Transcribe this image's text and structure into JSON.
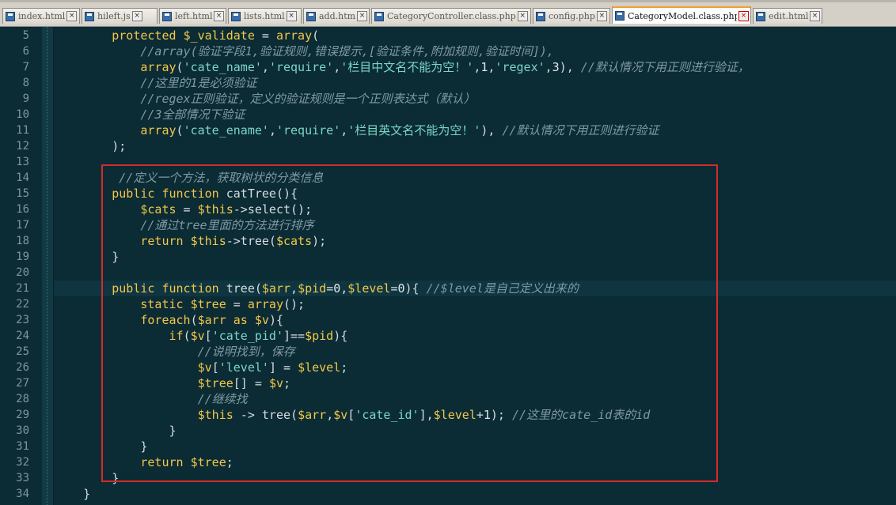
{
  "tabs": [
    {
      "label": "index.html",
      "active": false
    },
    {
      "label": "hileft.js",
      "active": false
    },
    {
      "label": "left.html",
      "active": false
    },
    {
      "label": "lists.html",
      "active": false
    },
    {
      "label": "add.html",
      "active": false
    },
    {
      "label": "CategoryController.class.php",
      "active": false
    },
    {
      "label": "config.php",
      "active": false
    },
    {
      "label": "CategoryModel.class.php",
      "active": true
    },
    {
      "label": "edit.html",
      "active": false
    }
  ],
  "colors": {
    "background": "#0b2b35",
    "keyword": "#f3c64a",
    "string": "#7bd7c5",
    "comment": "#7f9aa5",
    "highlight_box": "#d42b2b"
  },
  "code": {
    "current_line": 21,
    "lines": [
      {
        "n": "5",
        "fold": "",
        "tokens": [
          [
            "",
            "        "
          ],
          [
            "kw",
            "protected "
          ],
          [
            "var",
            "$_validate"
          ],
          [
            "op",
            " = "
          ],
          [
            "kw",
            "array"
          ],
          [
            "op",
            "("
          ]
        ]
      },
      {
        "n": "6",
        "fold": "",
        "tokens": [
          [
            "",
            "            "
          ],
          [
            "cmt",
            "//array(验证字段1,验证规则,错误提示,[验证条件,附加规则,验证时间]),"
          ]
        ]
      },
      {
        "n": "7",
        "fold": "",
        "tokens": [
          [
            "",
            "            "
          ],
          [
            "kw",
            "array"
          ],
          [
            "op",
            "("
          ],
          [
            "str",
            "'cate_name'"
          ],
          [
            "op",
            ","
          ],
          [
            "str",
            "'require'"
          ],
          [
            "op",
            ","
          ],
          [
            "str",
            "'栏目中文名不能为空！'"
          ],
          [
            "op",
            ","
          ],
          [
            "num",
            "1"
          ],
          [
            "op",
            ","
          ],
          [
            "str",
            "'regex'"
          ],
          [
            "op",
            ","
          ],
          [
            "num",
            "3"
          ],
          [
            "op",
            "), "
          ],
          [
            "cmt",
            "//默认情况下用正则进行验证，"
          ]
        ]
      },
      {
        "n": "8",
        "fold": "",
        "tokens": [
          [
            "",
            "            "
          ],
          [
            "cmt",
            "//这里的1是必须验证"
          ]
        ]
      },
      {
        "n": "9",
        "fold": "",
        "tokens": [
          [
            "",
            "            "
          ],
          [
            "cmt",
            "//regex正则验证，定义的验证规则是一个正则表达式（默认）"
          ]
        ]
      },
      {
        "n": "10",
        "fold": "",
        "tokens": [
          [
            "",
            "            "
          ],
          [
            "cmt",
            "//3全部情况下验证"
          ]
        ]
      },
      {
        "n": "11",
        "fold": "",
        "tokens": [
          [
            "",
            "            "
          ],
          [
            "kw",
            "array"
          ],
          [
            "op",
            "("
          ],
          [
            "str",
            "'cate_ename'"
          ],
          [
            "op",
            ","
          ],
          [
            "str",
            "'require'"
          ],
          [
            "op",
            ","
          ],
          [
            "str",
            "'栏目英文名不能为空！'"
          ],
          [
            "op",
            "), "
          ],
          [
            "cmt",
            "//默认情况下用正则进行验证"
          ]
        ]
      },
      {
        "n": "12",
        "fold": "",
        "tokens": [
          [
            "",
            "        "
          ],
          [
            "op",
            ");"
          ]
        ]
      },
      {
        "n": "13",
        "fold": "",
        "tokens": []
      },
      {
        "n": "14",
        "fold": "",
        "tokens": [
          [
            "",
            "         "
          ],
          [
            "cmt",
            "//定义一个方法，获取树状的分类信息"
          ]
        ]
      },
      {
        "n": "15",
        "fold": "box",
        "tokens": [
          [
            "",
            "        "
          ],
          [
            "kw",
            "public "
          ],
          [
            "kw",
            "function "
          ],
          [
            "op",
            "catTree(){"
          ]
        ]
      },
      {
        "n": "16",
        "fold": "",
        "tokens": [
          [
            "",
            "            "
          ],
          [
            "var",
            "$cats"
          ],
          [
            "op",
            " = "
          ],
          [
            "var",
            "$this"
          ],
          [
            "op",
            "->select();"
          ]
        ]
      },
      {
        "n": "17",
        "fold": "",
        "tokens": [
          [
            "",
            "            "
          ],
          [
            "cmt",
            "//通过tree里面的方法进行排序"
          ]
        ]
      },
      {
        "n": "18",
        "fold": "",
        "tokens": [
          [
            "",
            "            "
          ],
          [
            "kw",
            "return "
          ],
          [
            "var",
            "$this"
          ],
          [
            "op",
            "->tree("
          ],
          [
            "var",
            "$cats"
          ],
          [
            "op",
            ");"
          ]
        ]
      },
      {
        "n": "19",
        "fold": "",
        "tokens": [
          [
            "",
            "        "
          ],
          [
            "op",
            "}"
          ]
        ]
      },
      {
        "n": "20",
        "fold": "",
        "tokens": []
      },
      {
        "n": "21",
        "fold": "red",
        "tokens": [
          [
            "",
            "        "
          ],
          [
            "kw",
            "public "
          ],
          [
            "kw",
            "function "
          ],
          [
            "op",
            "tree("
          ],
          [
            "var",
            "$arr"
          ],
          [
            "op",
            ","
          ],
          [
            "var",
            "$pid"
          ],
          [
            "op",
            "="
          ],
          [
            "num",
            "0"
          ],
          [
            "op",
            ","
          ],
          [
            "var",
            "$level"
          ],
          [
            "op",
            "="
          ],
          [
            "num",
            "0"
          ],
          [
            "op",
            "){ "
          ],
          [
            "cmt",
            "//$level是自己定义出来的"
          ]
        ]
      },
      {
        "n": "22",
        "fold": "",
        "tokens": [
          [
            "",
            "            "
          ],
          [
            "kw",
            "static "
          ],
          [
            "var",
            "$tree"
          ],
          [
            "op",
            " = "
          ],
          [
            "kw",
            "array"
          ],
          [
            "op",
            "();"
          ]
        ]
      },
      {
        "n": "23",
        "fold": "red",
        "tokens": [
          [
            "",
            "            "
          ],
          [
            "kw",
            "foreach"
          ],
          [
            "op",
            "("
          ],
          [
            "var",
            "$arr"
          ],
          [
            "kw",
            " as "
          ],
          [
            "var",
            "$v"
          ],
          [
            "op",
            "){"
          ]
        ]
      },
      {
        "n": "24",
        "fold": "box",
        "tokens": [
          [
            "",
            "                "
          ],
          [
            "kw",
            "if"
          ],
          [
            "op",
            "("
          ],
          [
            "var",
            "$v"
          ],
          [
            "op",
            "["
          ],
          [
            "str",
            "'cate_pid'"
          ],
          [
            "op",
            "]=="
          ],
          [
            "var",
            "$pid"
          ],
          [
            "op",
            "){"
          ]
        ]
      },
      {
        "n": "25",
        "fold": "",
        "tokens": [
          [
            "",
            "                    "
          ],
          [
            "cmt",
            "//说明找到，保存"
          ]
        ]
      },
      {
        "n": "26",
        "fold": "",
        "tokens": [
          [
            "",
            "                    "
          ],
          [
            "var",
            "$v"
          ],
          [
            "op",
            "["
          ],
          [
            "str",
            "'level'"
          ],
          [
            "op",
            "] = "
          ],
          [
            "var",
            "$level"
          ],
          [
            "op",
            ";"
          ]
        ]
      },
      {
        "n": "27",
        "fold": "",
        "tokens": [
          [
            "",
            "                    "
          ],
          [
            "var",
            "$tree"
          ],
          [
            "op",
            "[] = "
          ],
          [
            "var",
            "$v"
          ],
          [
            "op",
            ";"
          ]
        ]
      },
      {
        "n": "28",
        "fold": "",
        "tokens": [
          [
            "",
            "                    "
          ],
          [
            "cmt",
            "//继续找"
          ]
        ]
      },
      {
        "n": "29",
        "fold": "",
        "tokens": [
          [
            "",
            "                    "
          ],
          [
            "var",
            "$this"
          ],
          [
            "op",
            " -> tree("
          ],
          [
            "var",
            "$arr"
          ],
          [
            "op",
            ","
          ],
          [
            "var",
            "$v"
          ],
          [
            "op",
            "["
          ],
          [
            "str",
            "'cate_id'"
          ],
          [
            "op",
            "],"
          ],
          [
            "var",
            "$level"
          ],
          [
            "op",
            "+"
          ],
          [
            "num",
            "1"
          ],
          [
            "op",
            "); "
          ],
          [
            "cmt",
            "//这里的cate_id表的id"
          ]
        ]
      },
      {
        "n": "30",
        "fold": "",
        "tokens": [
          [
            "",
            "                "
          ],
          [
            "op",
            "}"
          ]
        ]
      },
      {
        "n": "31",
        "fold": "",
        "tokens": [
          [
            "",
            "            "
          ],
          [
            "op",
            "}"
          ]
        ]
      },
      {
        "n": "32",
        "fold": "",
        "tokens": [
          [
            "",
            "            "
          ],
          [
            "kw",
            "return "
          ],
          [
            "var",
            "$tree"
          ],
          [
            "op",
            ";"
          ]
        ]
      },
      {
        "n": "33",
        "fold": "",
        "tokens": [
          [
            "",
            "        "
          ],
          [
            "op",
            "}"
          ]
        ]
      },
      {
        "n": "34",
        "fold": "",
        "tokens": [
          [
            "",
            "    "
          ],
          [
            "op",
            "}"
          ]
        ]
      }
    ]
  }
}
